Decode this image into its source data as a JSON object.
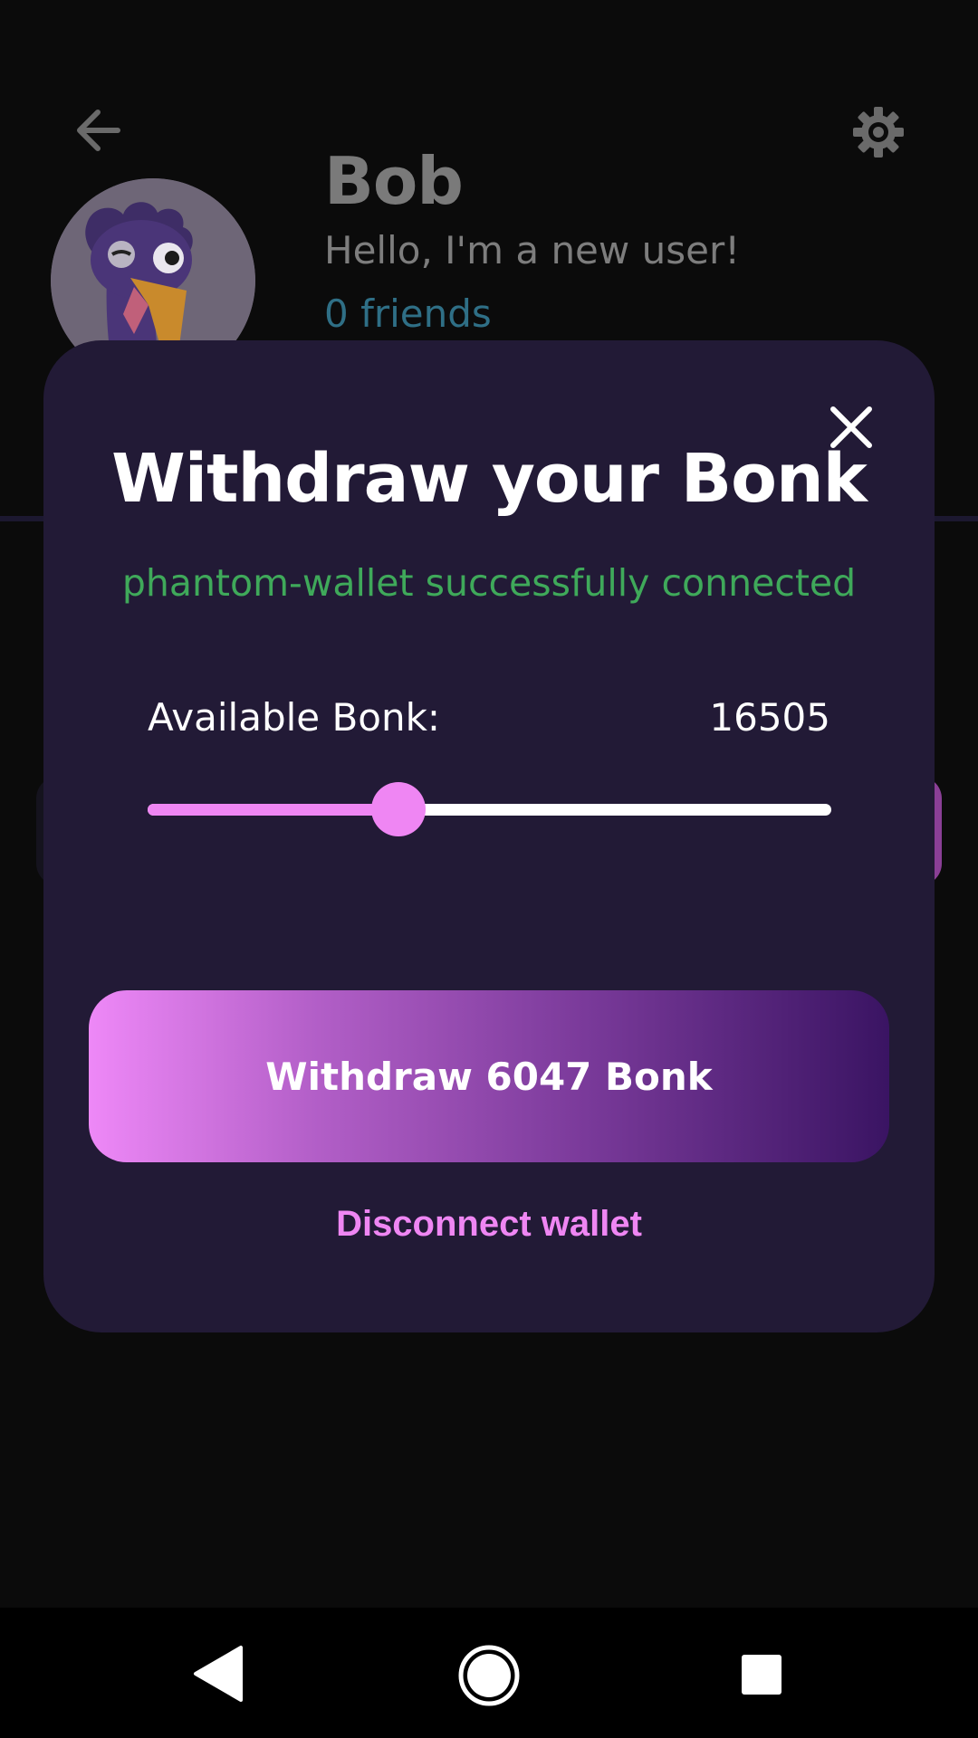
{
  "profile": {
    "name": "Bob",
    "bio": "Hello, I'm a new user!",
    "friends": "0 friends",
    "back_icon": "arrow-left-icon",
    "settings_icon": "gear-icon",
    "avatar": "turkey-avatar"
  },
  "modal": {
    "title": "Withdraw your Bonk",
    "status": "phantom-wallet successfully connected",
    "available_label": "Available Bonk:",
    "available_value": "16505",
    "slider_value": 6047,
    "slider_max": 16505,
    "withdraw_label": "Withdraw 6047 Bonk",
    "disconnect_label": "Disconnect wallet",
    "close_icon": "close-icon"
  },
  "colors": {
    "accent": "#ef86f3",
    "success": "#3fa95a",
    "modal_bg": "#221a36",
    "screen_bg": "#0b0b0b"
  },
  "navbar": {
    "back_icon": "triangle-back-icon",
    "home_icon": "circle-home-icon",
    "recents_icon": "square-recents-icon"
  }
}
